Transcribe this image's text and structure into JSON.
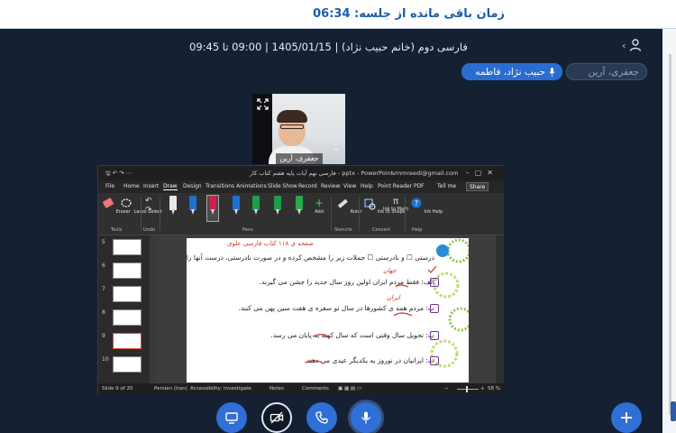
{
  "topbar": {
    "timer_label": "زمان باقی مانده از جلسه: 06:34"
  },
  "session": {
    "title": "فارسی دوم (خانم حبیب نژاد) | 1405/01/15 | 09:00 تا 09:45"
  },
  "participants": {
    "chip_active": "حبیب نژاد، فاطمه",
    "chip_muted": "جعفری، آرین"
  },
  "video_tile": {
    "name": "جعفری، آرین"
  },
  "ppt": {
    "filename": "فارسی نهم آیات پایه هفتم کتاب کار - pptx - PowerPoint",
    "account": "vmmreedi@gmail.com",
    "menu": [
      "File",
      "Home",
      "Insert",
      "Draw",
      "Design",
      "Transitions",
      "Animations",
      "Slide Show",
      "Record",
      "Review",
      "View",
      "Help",
      "Point Reader PDF",
      "Tell me"
    ],
    "active_menu": "Draw",
    "share_label": "Share",
    "ribbon": {
      "eraser": "Eraser",
      "lasso": "Lasso Select",
      "tools_group": "Tools",
      "undo_group": "Undo",
      "add": "Add",
      "pens_group": "Pens",
      "ruler": "Ruler",
      "stencils_group": "Stencils",
      "ink_to_shape": "Ink to Shape",
      "ink_to_math": "Ink to Math",
      "convert_group": "Convert",
      "ink_help": "Ink Help",
      "help_group": "Help"
    },
    "pen_colors": [
      "#e8e8e8",
      "#1f6fd1",
      "#d21d4e",
      "#1f6fd1",
      "#1e9e4a",
      "#1e9e4a",
      "#1e9e4a",
      "#2aa84f"
    ],
    "slides": [
      "5",
      "6",
      "7",
      "8",
      "9",
      "10"
    ],
    "selected_slide": "9",
    "slide": {
      "header": "صفحه ی ۱۱۸ کتاب فارسی علوی",
      "lines": [
        "درستی ☐ و نادرستی ☐ جملات زیر را مشخص کرده و در صورت نادرستی، درست آنها را بنویسید.",
        "الف: فقط مردم ایران اولین روز سال جدید را جشن می گیرند.",
        "ب: مردم همه ی کشورها در سال نو سفره ی هفت سین پهن می کنند.",
        "پ: تحویل سال وقتی است که سال کهنه به پایان می رسد.",
        "ت: ایرانیان در نوروز به یکدیگر عیدی می دهند."
      ],
      "annotations": [
        "جهان",
        "ایران"
      ]
    },
    "status": {
      "slide_count": "Slide 9 of 20",
      "language": "Persian (Iran)",
      "accessibility": "Accessibility: Investigate",
      "notes": "Notes",
      "comments": "Comments",
      "zoom": "58 %"
    }
  },
  "controls": {
    "screen_share": "screen-share",
    "camera": "camera-off",
    "call": "phone",
    "mic": "microphone",
    "add": "plus"
  }
}
